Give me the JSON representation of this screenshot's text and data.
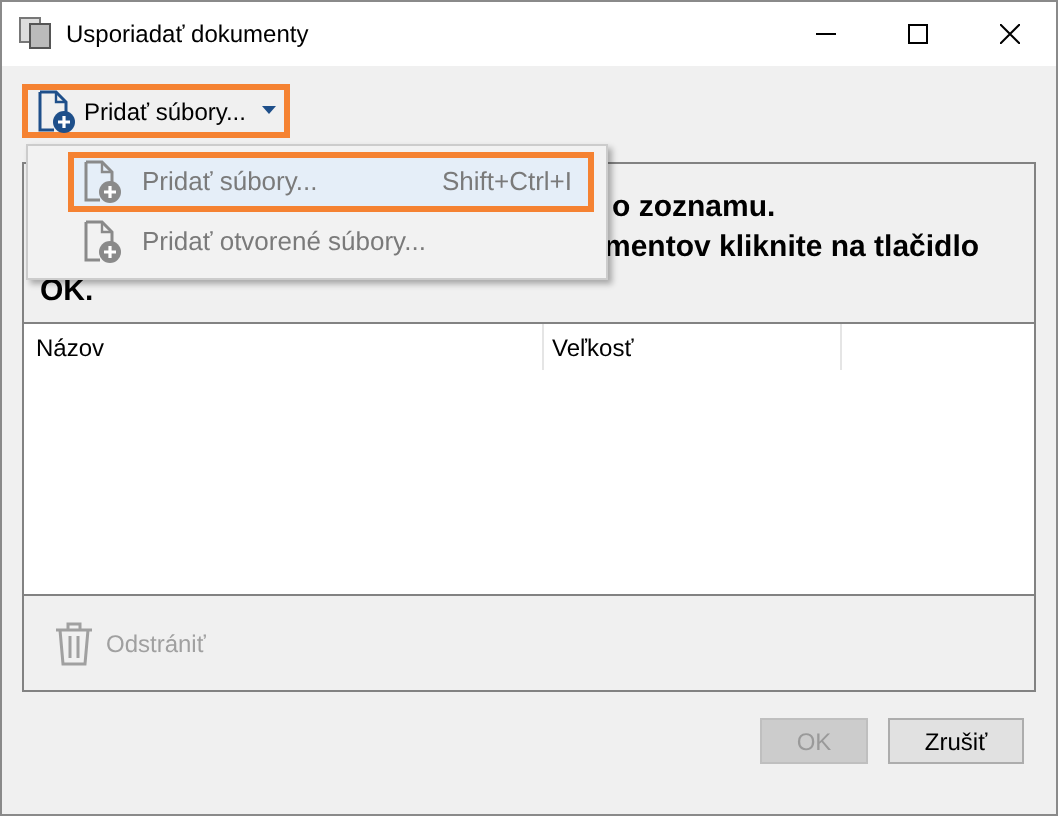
{
  "window": {
    "title": "Usporiadať dokumenty"
  },
  "toolbar": {
    "add_button": {
      "label": "Pridať súbory...",
      "highlighted": true
    }
  },
  "menu": {
    "items": [
      {
        "label": "Pridať súbory...",
        "shortcut": "Shift+Ctrl+I",
        "selected": true
      },
      {
        "label": "Pridať otvorené súbory...",
        "selected": false
      }
    ]
  },
  "instructions": [
    "o zoznamu.",
    "mentov kliknite na tlačidlo",
    "OK."
  ],
  "table": {
    "columns": [
      "Názov",
      "Veľkosť"
    ]
  },
  "remove_button": {
    "label": "Odstrániť",
    "disabled": true
  },
  "buttons": [
    {
      "label": "OK",
      "disabled": true
    },
    {
      "label": "Zrušiť",
      "disabled": false
    }
  ]
}
